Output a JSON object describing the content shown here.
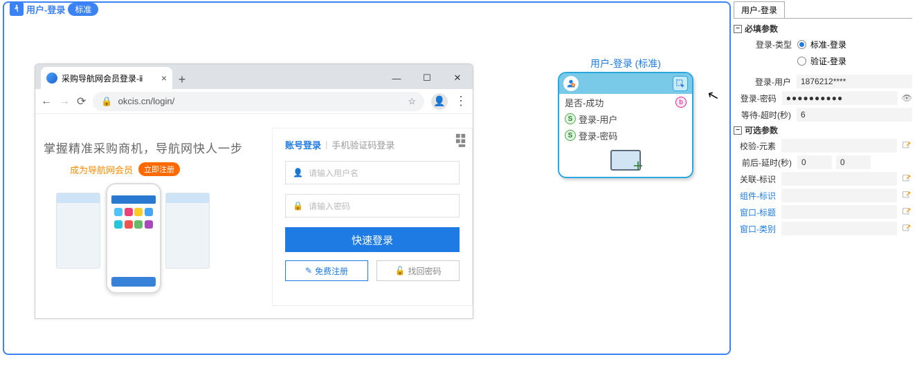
{
  "main": {
    "title": "用户-登录",
    "pill": "标准"
  },
  "browser": {
    "tab_title": "采购导航网会员登录-ⅱ",
    "url": "okcis.cn/login/",
    "slogan": "掌握精准采购商机，导航网快人一步",
    "member_text": "成为导航网会员",
    "reg_now": "立即注册",
    "login_tabs": {
      "active": "账号登录",
      "other": "手机验证码登录"
    },
    "placeholders": {
      "user": "请输入用户名",
      "pass": "请输入密码"
    },
    "login_btn": "快速登录",
    "free_reg": "免费注册",
    "find_pw": "找回密码"
  },
  "node": {
    "title": "用户-登录 (标准)",
    "success": "是否-成功",
    "rows": {
      "user": "登录-用户",
      "pass": "登录-密码"
    }
  },
  "panel": {
    "tab": "用户-登录",
    "group1": "必填参数",
    "group2": "可选参数",
    "login_type_label": "登录-类型",
    "login_type_opts": {
      "std": "标准-登录",
      "ver": "验证-登录"
    },
    "login_user_label": "登录-用户",
    "login_user_val": "1876212****",
    "login_pass_label": "登录-密码",
    "login_pass_val": "●●●●●●●●●●",
    "wait_label": "等待-超时(秒)",
    "wait_val": "6",
    "verify_label": "校验-元素",
    "delay_label": "前后-延时(秒)",
    "delay_a": "0",
    "delay_b": "0",
    "assoc_label": "关联-标识",
    "comp_label": "组件-标识",
    "win_title_label": "窗口-标题",
    "win_class_label": "窗口-类别"
  }
}
